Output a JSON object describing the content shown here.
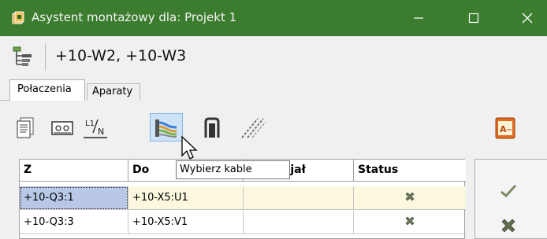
{
  "window": {
    "title": "Asystent montażowy dla: Projekt 1",
    "accent": "#3b7c2f"
  },
  "header": {
    "title": "+10-W2, +10-W3",
    "icon": "tree-structure-icon"
  },
  "tabs": [
    {
      "label": "Połaczenia",
      "active": true
    },
    {
      "label": "Aparaty",
      "active": false
    }
  ],
  "toolbar": {
    "icons": [
      "document-icon",
      "terminal-icon",
      "phase-neutral-icon",
      "select-cables-icon",
      "connector-icon",
      "wires-icon"
    ],
    "report_icon": "report-icon",
    "selected": "select-cables-icon"
  },
  "tooltip": {
    "text": "Wybierz kable"
  },
  "table": {
    "columns": [
      "Z",
      "Do",
      "Potencjał",
      "Status"
    ],
    "rows": [
      {
        "z": "+10-Q3:1",
        "do": "+10-X5:U1",
        "potencjal": "",
        "status": "x-icon"
      },
      {
        "z": "+10-Q3:3",
        "do": "+10-X5:V1",
        "potencjal": "",
        "status": "x-icon"
      }
    ]
  },
  "side_buttons": [
    "checkmark-icon",
    "cross-icon"
  ]
}
